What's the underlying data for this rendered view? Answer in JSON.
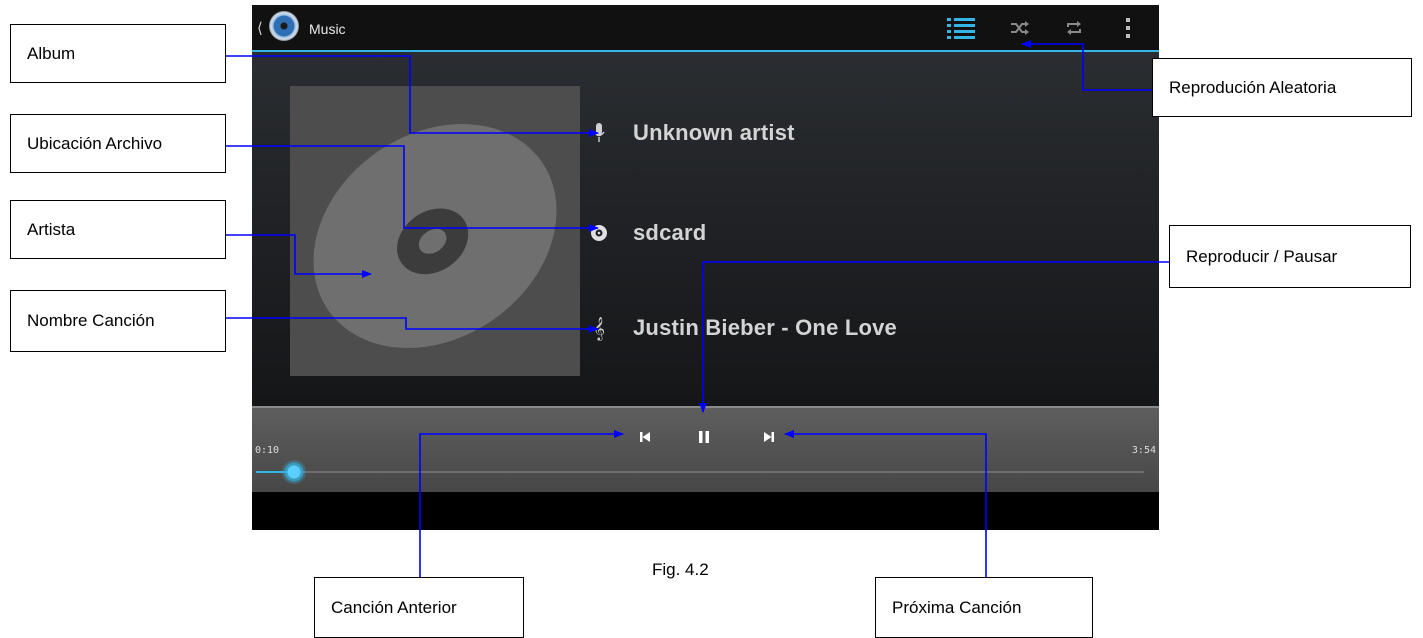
{
  "app": {
    "title": "Music",
    "actions": [
      "playlist-icon",
      "shuffle-icon",
      "repeat-icon",
      "overflow-icon"
    ],
    "accent_color": "#33b5e5"
  },
  "track": {
    "artist": "Unknown artist",
    "album": "sdcard",
    "song": "Justin Bieber - One Love"
  },
  "player": {
    "current_time": "0:10",
    "total_time": "3:54",
    "progress": 0.043,
    "state": "playing"
  },
  "callouts": {
    "album": "Album",
    "file_location": "Ubicación Archivo",
    "artist": "Artista",
    "song_name": "Nombre Canción",
    "shuffle": "Reprodución Aleatoria",
    "play_pause": "Reproducir / Pausar",
    "previous": "Canción Anterior",
    "next": "Próxima Canción"
  },
  "figure_caption": "Fig. 4.2"
}
